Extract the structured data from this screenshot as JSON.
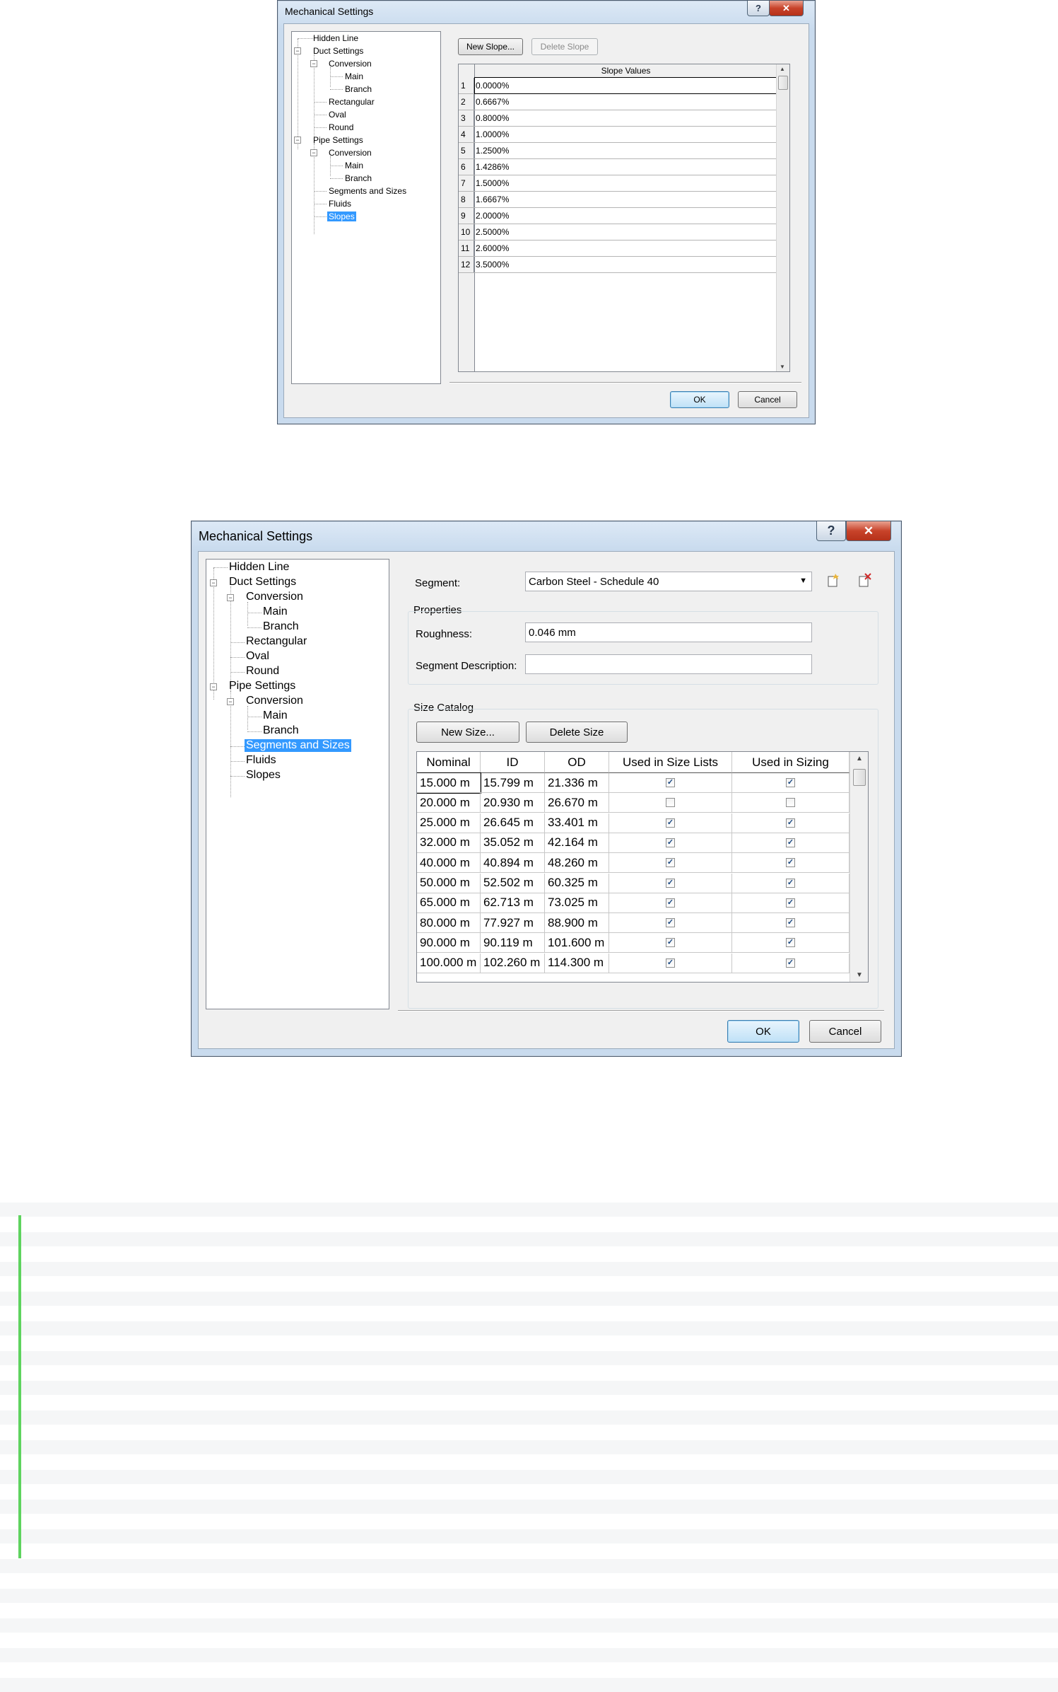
{
  "dialog_slopes": {
    "title": "Mechanical Settings",
    "help_glyph": "?",
    "close_glyph": "✕",
    "tree": {
      "hidden_line": "Hidden Line",
      "duct_settings": "Duct Settings",
      "duct_conversion": "Conversion",
      "duct_main": "Main",
      "duct_branch": "Branch",
      "rectangular": "Rectangular",
      "oval": "Oval",
      "round": "Round",
      "pipe_settings": "Pipe Settings",
      "pipe_conversion": "Conversion",
      "pipe_main": "Main",
      "pipe_branch": "Branch",
      "segments_sizes": "Segments and Sizes",
      "fluids": "Fluids",
      "slopes": "Slopes"
    },
    "new_slope_label": "New Slope...",
    "delete_slope_label": "Delete Slope",
    "column_header": "Slope Values",
    "rows": [
      {
        "n": "1",
        "v": "0.0000%"
      },
      {
        "n": "2",
        "v": "0.6667%"
      },
      {
        "n": "3",
        "v": "0.8000%"
      },
      {
        "n": "4",
        "v": "1.0000%"
      },
      {
        "n": "5",
        "v": "1.2500%"
      },
      {
        "n": "6",
        "v": "1.4286%"
      },
      {
        "n": "7",
        "v": "1.5000%"
      },
      {
        "n": "8",
        "v": "1.6667%"
      },
      {
        "n": "9",
        "v": "2.0000%"
      },
      {
        "n": "10",
        "v": "2.5000%"
      },
      {
        "n": "11",
        "v": "2.6000%"
      },
      {
        "n": "12",
        "v": "3.5000%"
      }
    ],
    "ok_label": "OK",
    "cancel_label": "Cancel"
  },
  "dialog_segments": {
    "title": "Mechanical Settings",
    "help_glyph": "?",
    "close_glyph": "✕",
    "tree": {
      "hidden_line": "Hidden Line",
      "duct_settings": "Duct Settings",
      "duct_conversion": "Conversion",
      "duct_main": "Main",
      "duct_branch": "Branch",
      "rectangular": "Rectangular",
      "oval": "Oval",
      "round": "Round",
      "pipe_settings": "Pipe Settings",
      "pipe_conversion": "Conversion",
      "pipe_main": "Main",
      "pipe_branch": "Branch",
      "segments_sizes": "Segments and Sizes",
      "fluids": "Fluids",
      "slopes": "Slopes"
    },
    "segment_label": "Segment:",
    "segment_value": "Carbon Steel - Schedule 40",
    "properties_label": "Properties",
    "roughness_label": "Roughness:",
    "roughness_value": "0.046 mm",
    "description_label": "Segment Description:",
    "description_value": "",
    "size_catalog_label": "Size Catalog",
    "new_size_label": "New Size...",
    "delete_size_label": "Delete Size",
    "columns": {
      "nominal": "Nominal",
      "id": "ID",
      "od": "OD",
      "used_lists": "Used in Size Lists",
      "used_sizing": "Used in Sizing"
    },
    "rows": [
      {
        "nominal": "15.000 m",
        "id": "15.799 m",
        "od": "21.336 m",
        "lists": true,
        "sizing": true
      },
      {
        "nominal": "20.000 m",
        "id": "20.930 m",
        "od": "26.670 m",
        "lists": false,
        "sizing": false
      },
      {
        "nominal": "25.000 m",
        "id": "26.645 m",
        "od": "33.401 m",
        "lists": true,
        "sizing": true
      },
      {
        "nominal": "32.000 m",
        "id": "35.052 m",
        "od": "42.164 m",
        "lists": true,
        "sizing": true
      },
      {
        "nominal": "40.000 m",
        "id": "40.894 m",
        "od": "48.260 m",
        "lists": true,
        "sizing": true
      },
      {
        "nominal": "50.000 m",
        "id": "52.502 m",
        "od": "60.325 m",
        "lists": true,
        "sizing": true
      },
      {
        "nominal": "65.000 m",
        "id": "62.713 m",
        "od": "73.025 m",
        "lists": true,
        "sizing": true
      },
      {
        "nominal": "80.000 m",
        "id": "77.927 m",
        "od": "88.900 m",
        "lists": true,
        "sizing": true
      },
      {
        "nominal": "90.000 m",
        "id": "90.119 m",
        "od": "101.600 m",
        "lists": true,
        "sizing": true
      },
      {
        "nominal": "100.000 m",
        "id": "102.260 m",
        "od": "114.300 m",
        "lists": true,
        "sizing": true
      }
    ],
    "ok_label": "OK",
    "cancel_label": "Cancel"
  },
  "colors": {
    "selection": "#3399ff",
    "accent_green": "#5ed35e",
    "close_red": "#c8432a"
  }
}
